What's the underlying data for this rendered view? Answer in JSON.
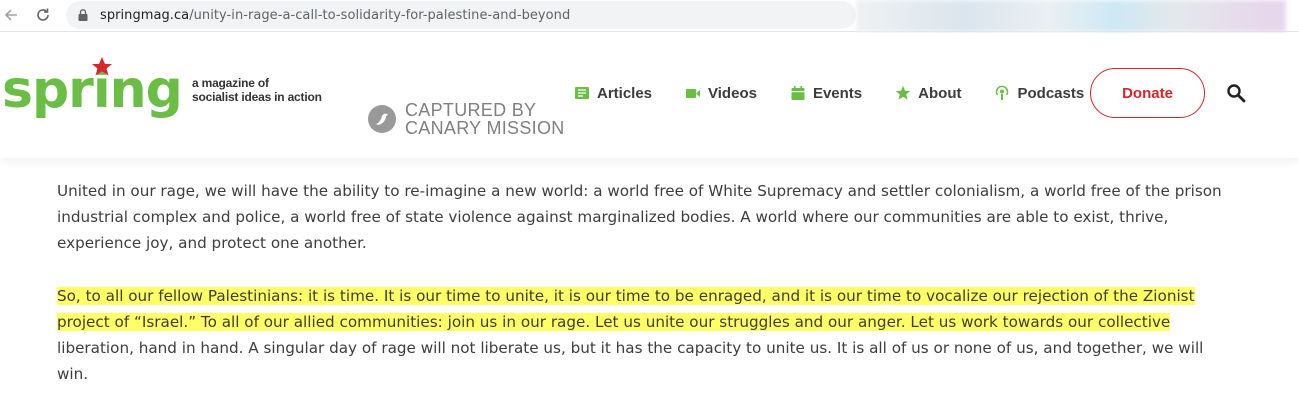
{
  "browser": {
    "url_domain": "springmag.ca",
    "url_path": "/unity-in-rage-a-call-to-solidarity-for-palestine-and-beyond"
  },
  "site": {
    "logo_text": "spring",
    "tagline_line1": "a magazine of",
    "tagline_line2": "socialist ideas in action",
    "brand_colors": {
      "green": "#6abd45",
      "red": "#d6262b"
    }
  },
  "watermark": {
    "line1": "CAPTURED BY",
    "line2": "CANARY MISSION"
  },
  "nav": {
    "items": [
      {
        "label": "Articles",
        "icon": "articles-icon"
      },
      {
        "label": "Videos",
        "icon": "video-camera-icon"
      },
      {
        "label": "Events",
        "icon": "calendar-icon"
      },
      {
        "label": "About",
        "icon": "star-icon"
      },
      {
        "label": "Podcasts",
        "icon": "podcast-icon"
      }
    ],
    "donate_label": "Donate",
    "search_icon": "search-icon"
  },
  "article": {
    "paragraph1": "United in our rage, we will have the ability to re-imagine a new world: a world free of White Supremacy and settler colonialism, a world free of the prison industrial complex and police, a world free of state violence against marginalized bodies. A world where our communities are able to exist, thrive, experience joy, and protect one another.",
    "paragraph2_highlighted": "So, to all our fellow Palestinians: it is time. It is our time to unite, it is our time to be enraged, and it is our time to vocalize our rejection of the Zionist project of “Israel.” To all of our allied communities: join us in our rage. Let us unite our struggles and our anger. Let us work towards our collective",
    "paragraph2_rest": " liberation, hand in hand. A singular day of rage will not liberate us, but it has the capacity to unite us. It is all of us or none of us, and together, we will win.",
    "highlight_color": "#ffff66"
  }
}
